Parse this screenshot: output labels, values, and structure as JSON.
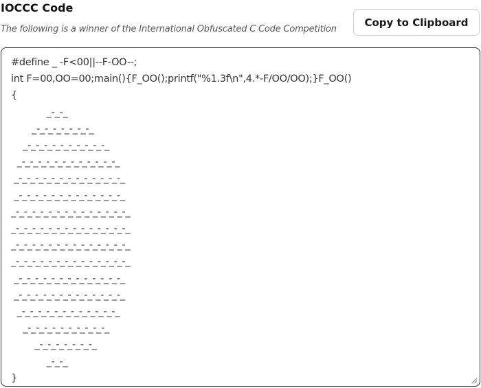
{
  "header": {
    "title": "IOCCC Code",
    "subtitle": "The following is a winner of the International Obfuscated C Code Competition",
    "copy_button_label": "Copy to Clipboard"
  },
  "code": {
    "text": "#define _ -F<00||--F-OO--;\nint F=00,OO=00;main(){F_OO();printf(\"%1.3f\\n\",4.*-F/OO/OO);}F_OO()\n{\n            _-_-_\n       _-_-_-_-_-_-_-_\n    _-_-_-_-_-_-_-_-_-_-_\n  _-_-_-_-_-_-_-_-_-_-_-_-_\n _-_-_-_-_-_-_-_-_-_-_-_-_-_\n _-_-_-_-_-_-_-_-_-_-_-_-_-_\n_-_-_-_-_-_-_-_-_-_-_-_-_-_-_\n_-_-_-_-_-_-_-_-_-_-_-_-_-_-_\n_-_-_-_-_-_-_-_-_-_-_-_-_-_-_\n_-_-_-_-_-_-_-_-_-_-_-_-_-_-_\n _-_-_-_-_-_-_-_-_-_-_-_-_-_\n _-_-_-_-_-_-_-_-_-_-_-_-_-_\n  _-_-_-_-_-_-_-_-_-_-_-_-_\n    _-_-_-_-_-_-_-_-_-_-_\n        _-_-_-_-_-_-_-_\n            _-_-_\n}"
  },
  "icons": {
    "resize_grip": "resize-grip-icon"
  }
}
